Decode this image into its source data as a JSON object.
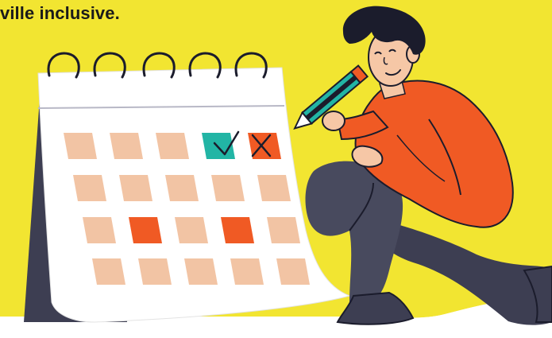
{
  "headline": "ville inclusive.",
  "colors": {
    "background": "#f2e531",
    "floor": "#ffffff",
    "calendar_paper": "#ffffff",
    "calendar_shadow": "#3d3e52",
    "cell_default": "#f2c4a4",
    "cell_highlight": "#f05a24",
    "cell_checked": "#22b5a5",
    "cell_crossed": "#f05a24",
    "shirt": "#f05a24",
    "pants": "#484a5e",
    "skin": "#f6c7a6",
    "hair": "#1b1c2c",
    "pencil_body": "#22b5a5",
    "pencil_tip": "#f05a24",
    "outline": "#1b1c2c"
  },
  "calendar": {
    "rows": [
      [
        "default",
        "default",
        "default",
        "checked",
        "crossed"
      ],
      [
        "default",
        "default",
        "default",
        "default",
        "default"
      ],
      [
        "default",
        "highlight",
        "default",
        "highlight",
        "default"
      ],
      [
        "default",
        "default",
        "default",
        "default",
        "default"
      ]
    ]
  },
  "icons": {
    "checkmark": "check-icon",
    "cross": "cross-icon"
  }
}
